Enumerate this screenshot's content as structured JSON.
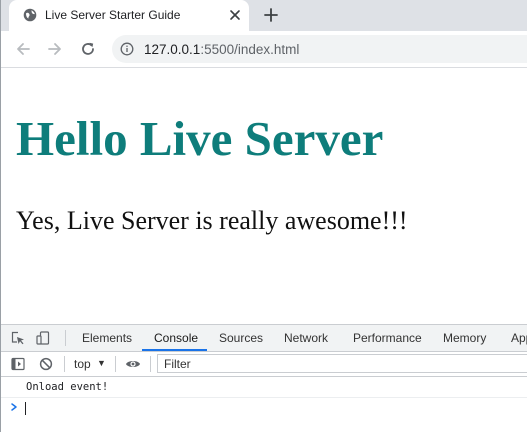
{
  "browser": {
    "tab": {
      "title": "Live Server Starter Guide",
      "favicon": "globe-icon",
      "close_icon": "close-icon"
    },
    "new_tab_icon": "plus-icon",
    "toolbar": {
      "back_icon": "arrow-left-icon",
      "forward_icon": "arrow-right-icon",
      "reload_icon": "reload-icon",
      "info_icon": "info-icon",
      "url_host": "127.0.0.1",
      "url_rest": ":5500/index.html"
    }
  },
  "page": {
    "heading": "Hello Live Server",
    "paragraph": "Yes, Live Server is really awesome!!!",
    "heading_color": "#0e7d7b"
  },
  "devtools": {
    "tabs": [
      {
        "label": "Elements",
        "active": false
      },
      {
        "label": "Console",
        "active": true
      },
      {
        "label": "Sources",
        "active": false
      },
      {
        "label": "Network",
        "active": false
      },
      {
        "label": "Performance",
        "active": false
      },
      {
        "label": "Memory",
        "active": false
      },
      {
        "label": "App",
        "active": false
      }
    ],
    "console_toolbar": {
      "context_value": "top",
      "filter_placeholder": "Filter"
    },
    "log_messages": [
      "Onload event!"
    ],
    "accent_color": "#1a73e8"
  }
}
